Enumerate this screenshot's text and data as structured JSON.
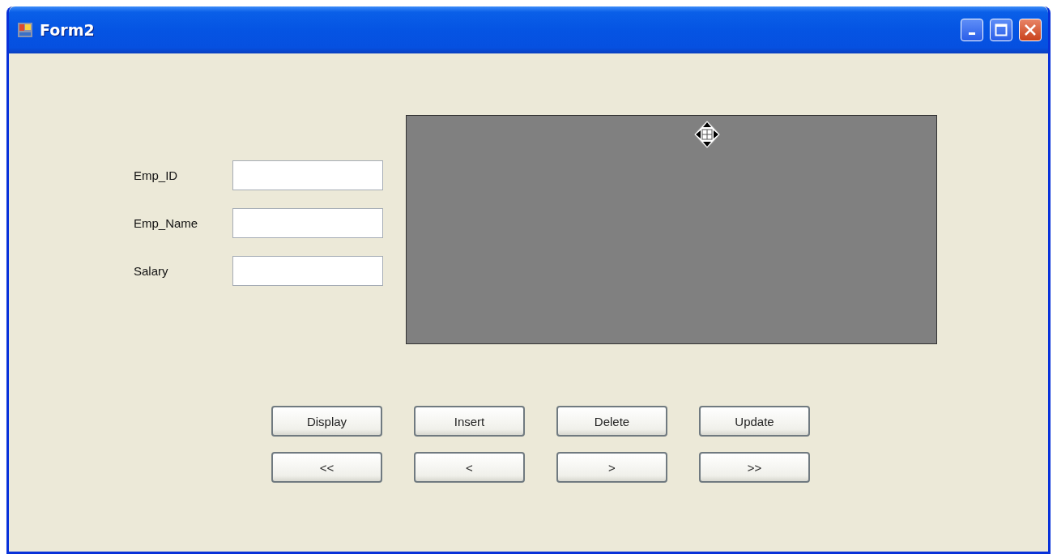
{
  "window": {
    "title": "Form2"
  },
  "fields": [
    {
      "label": "Emp_ID"
    },
    {
      "label": "Emp_Name"
    },
    {
      "label": "Salary"
    }
  ],
  "grid": {
    "kind": "empty",
    "move_handle": true
  },
  "button_rows": [
    [
      "Display",
      "Insert",
      "Delete",
      "Update"
    ],
    [
      "<<",
      "<",
      ">",
      ">>"
    ]
  ]
}
